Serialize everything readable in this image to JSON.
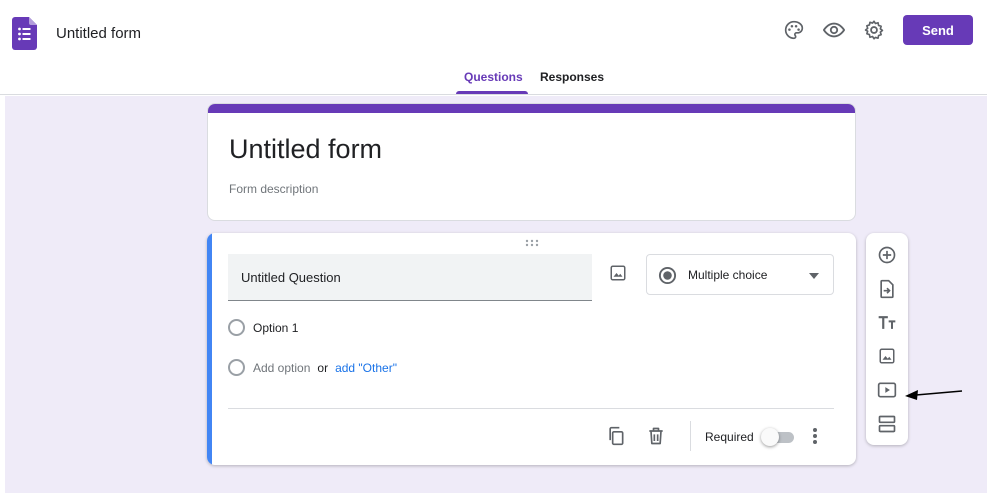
{
  "header": {
    "title": "Untitled form",
    "icons": [
      "palette-icon",
      "eye-icon",
      "gear-icon"
    ],
    "send_label": "Send",
    "accent_color": "#673ab7"
  },
  "tabs": [
    {
      "label": "Questions",
      "active": true
    },
    {
      "label": "Responses",
      "active": false
    }
  ],
  "form": {
    "title": "Untitled form",
    "description_placeholder": "Form description"
  },
  "question": {
    "title_placeholder": "Untitled Question",
    "type_label": "Multiple choice",
    "options": [
      "Option 1"
    ],
    "add_option_label": "Add option",
    "or_label": "or",
    "add_other_label": "add \"Other\"",
    "required_label": "Required",
    "required": false
  },
  "side_toolbar": {
    "tools": [
      "add-question-icon",
      "import-questions-icon",
      "add-title-icon",
      "add-image-icon",
      "add-video-icon",
      "add-section-icon"
    ]
  }
}
